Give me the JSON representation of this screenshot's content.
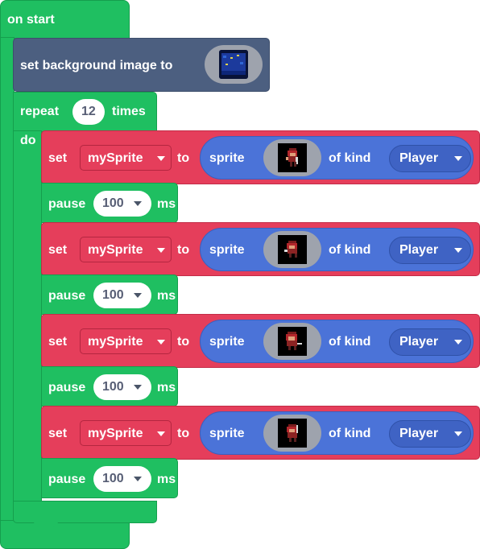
{
  "event": {
    "label": "on start"
  },
  "background": {
    "label": "set background image to",
    "image_icon": "tilemap-thumbnail-icon"
  },
  "repeat": {
    "label": "repeat",
    "count": "12",
    "times_label": "times",
    "do_label": "do"
  },
  "rows": [
    {
      "set_label": "set",
      "variable": "mySprite",
      "to_label": "to",
      "sprite_label": "sprite",
      "of_kind_label": "of kind",
      "kind": "Player",
      "pause_label": "pause",
      "pause_value": "100",
      "ms_label": "ms"
    },
    {
      "set_label": "set",
      "variable": "mySprite",
      "to_label": "to",
      "sprite_label": "sprite",
      "of_kind_label": "of kind",
      "kind": "Player",
      "pause_label": "pause",
      "pause_value": "100",
      "ms_label": "ms"
    },
    {
      "set_label": "set",
      "variable": "mySprite",
      "to_label": "to",
      "sprite_label": "sprite",
      "of_kind_label": "of kind",
      "kind": "Player",
      "pause_label": "pause",
      "pause_value": "100",
      "ms_label": "ms"
    },
    {
      "set_label": "set",
      "variable": "mySprite",
      "to_label": "to",
      "sprite_label": "sprite",
      "of_kind_label": "of kind",
      "kind": "Player",
      "pause_label": "pause",
      "pause_value": "100",
      "ms_label": "ms"
    }
  ],
  "colors": {
    "loops": "#1fbf61",
    "variables": "#e53e5b",
    "scene": "#4c5f80",
    "sprites": "#4b73d8"
  }
}
